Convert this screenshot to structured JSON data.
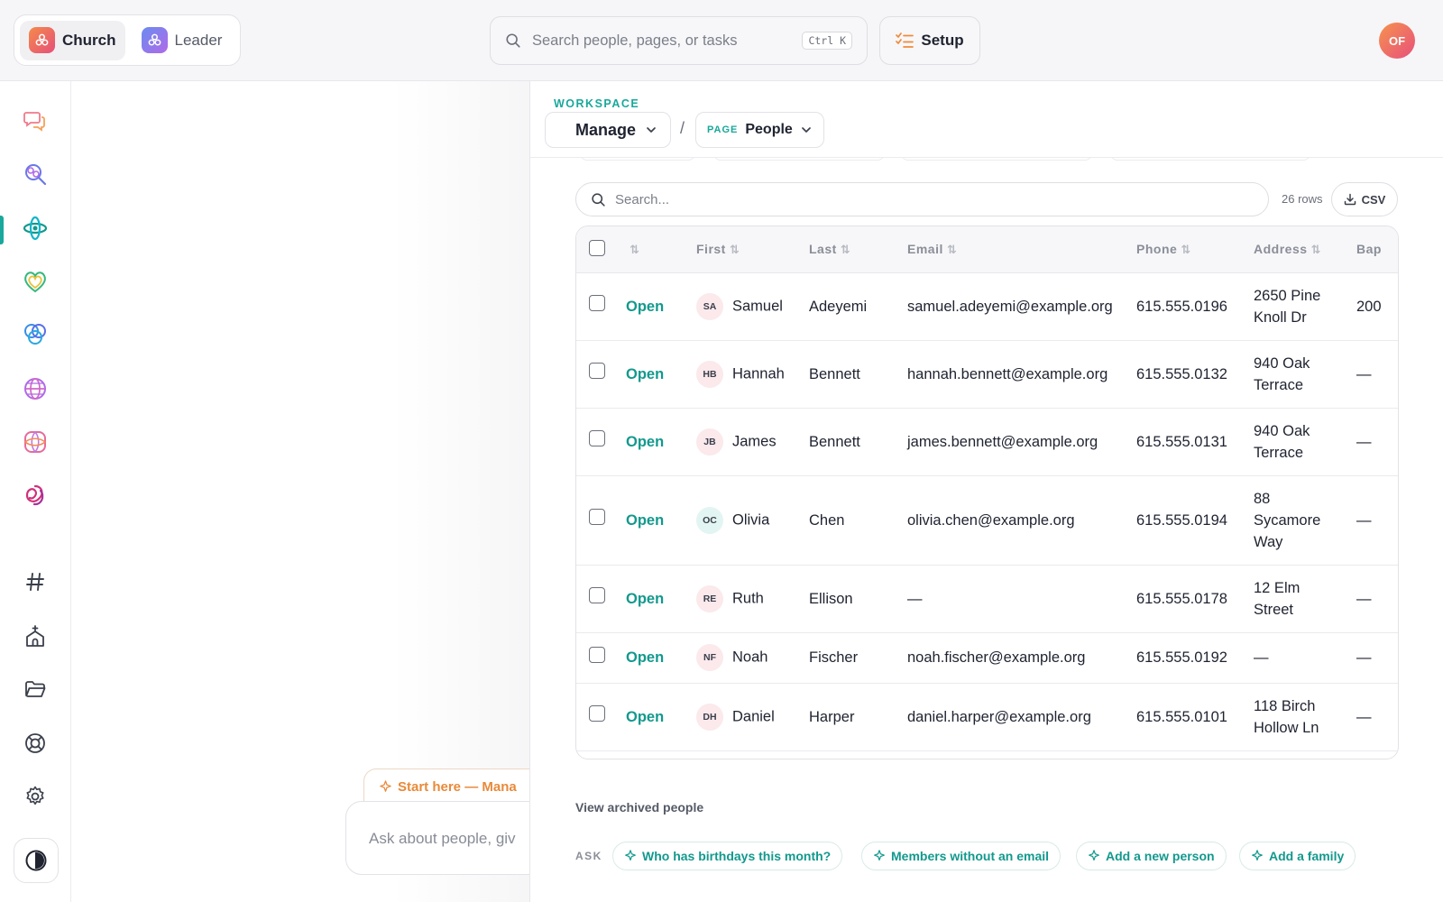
{
  "topbar": {
    "switcher": [
      {
        "label": "Church",
        "active": true
      },
      {
        "label": "Leader",
        "active": false
      }
    ],
    "search": {
      "placeholder": "Search people, pages, or tasks",
      "shortcut": "Ctrl K"
    },
    "setup_label": "Setup",
    "avatar_initials": "OF"
  },
  "sidebar": {
    "items": [
      "chat-icon",
      "search-people-icon",
      "tool-icon",
      "heart-icon",
      "rings-icon",
      "globe-icon",
      "flower-icon",
      "knot-icon",
      "hashtag-icon",
      "church-icon",
      "folder-icon",
      "lifebuoy-icon",
      "gear-icon"
    ],
    "active_index": 2
  },
  "assistant": {
    "start_chip": "Start here — Mana",
    "ask_placeholder": "Ask about people, giv"
  },
  "workspace": {
    "label": "WORKSPACE",
    "manage_label": "Manage",
    "separator": "/",
    "page_tag": "PAGE",
    "page_label": "People"
  },
  "table_tools": {
    "search_placeholder": "Search...",
    "rows_count": "26 rows",
    "csv_label": "CSV"
  },
  "table": {
    "columns": [
      "First",
      "Last",
      "Email",
      "Phone",
      "Address",
      "Bap"
    ],
    "open_label": "Open",
    "rows": [
      {
        "initials": "SA",
        "first": "Samuel",
        "last": "Adeyemi",
        "email": "samuel.adeyemi@example.org",
        "phone": "615.555.0196",
        "address": "2650 Pine Knoll Dr",
        "bap": "200"
      },
      {
        "initials": "HB",
        "first": "Hannah",
        "last": "Bennett",
        "email": "hannah.bennett@example.org",
        "phone": "615.555.0132",
        "address": "940 Oak Terrace",
        "bap": "—"
      },
      {
        "initials": "JB",
        "first": "James",
        "last": "Bennett",
        "email": "james.bennett@example.org",
        "phone": "615.555.0131",
        "address": "940 Oak Terrace",
        "bap": "—"
      },
      {
        "initials": "OC",
        "first": "Olivia",
        "last": "Chen",
        "email": "olivia.chen@example.org",
        "phone": "615.555.0194",
        "address": "88 Sycamore Way",
        "bap": "—"
      },
      {
        "initials": "RE",
        "first": "Ruth",
        "last": "Ellison",
        "email": "—",
        "phone": "615.555.0178",
        "address": "12 Elm Street",
        "bap": "—"
      },
      {
        "initials": "NF",
        "first": "Noah",
        "last": "Fischer",
        "email": "noah.fischer@example.org",
        "phone": "615.555.0192",
        "address": "—",
        "bap": "—"
      },
      {
        "initials": "DH",
        "first": "Daniel",
        "last": "Harper",
        "email": "daniel.harper@example.org",
        "phone": "615.555.0101",
        "address": "118 Birch Hollow Ln",
        "bap": "—"
      }
    ]
  },
  "footer": {
    "archived_link": "View archived people",
    "ask_label": "ASK",
    "suggestions": [
      "Who has birthdays this month?",
      "Members without an email",
      "Add a new person",
      "Add a family"
    ]
  },
  "colors": {
    "accent": "#19a89b",
    "brand_orange": "#f5934e",
    "brand_pink": "#e84f7c"
  }
}
